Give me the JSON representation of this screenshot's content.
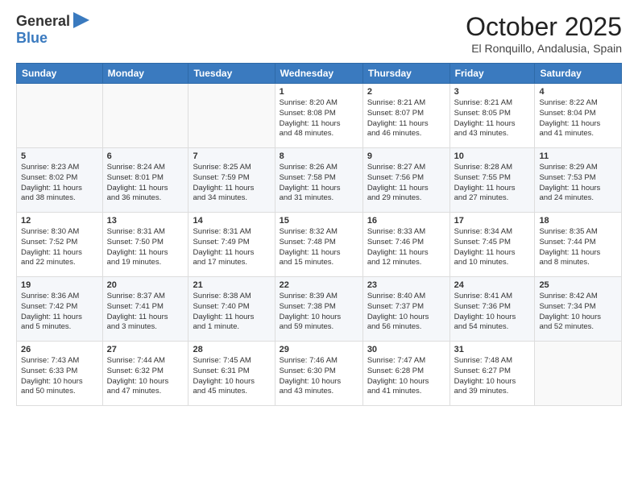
{
  "header": {
    "logo_line1": "General",
    "logo_line2": "Blue",
    "month": "October 2025",
    "location": "El Ronquillo, Andalusia, Spain"
  },
  "weekdays": [
    "Sunday",
    "Monday",
    "Tuesday",
    "Wednesday",
    "Thursday",
    "Friday",
    "Saturday"
  ],
  "weeks": [
    [
      {
        "day": "",
        "info": ""
      },
      {
        "day": "",
        "info": ""
      },
      {
        "day": "",
        "info": ""
      },
      {
        "day": "1",
        "info": "Sunrise: 8:20 AM\nSunset: 8:08 PM\nDaylight: 11 hours\nand 48 minutes."
      },
      {
        "day": "2",
        "info": "Sunrise: 8:21 AM\nSunset: 8:07 PM\nDaylight: 11 hours\nand 46 minutes."
      },
      {
        "day": "3",
        "info": "Sunrise: 8:21 AM\nSunset: 8:05 PM\nDaylight: 11 hours\nand 43 minutes."
      },
      {
        "day": "4",
        "info": "Sunrise: 8:22 AM\nSunset: 8:04 PM\nDaylight: 11 hours\nand 41 minutes."
      }
    ],
    [
      {
        "day": "5",
        "info": "Sunrise: 8:23 AM\nSunset: 8:02 PM\nDaylight: 11 hours\nand 38 minutes."
      },
      {
        "day": "6",
        "info": "Sunrise: 8:24 AM\nSunset: 8:01 PM\nDaylight: 11 hours\nand 36 minutes."
      },
      {
        "day": "7",
        "info": "Sunrise: 8:25 AM\nSunset: 7:59 PM\nDaylight: 11 hours\nand 34 minutes."
      },
      {
        "day": "8",
        "info": "Sunrise: 8:26 AM\nSunset: 7:58 PM\nDaylight: 11 hours\nand 31 minutes."
      },
      {
        "day": "9",
        "info": "Sunrise: 8:27 AM\nSunset: 7:56 PM\nDaylight: 11 hours\nand 29 minutes."
      },
      {
        "day": "10",
        "info": "Sunrise: 8:28 AM\nSunset: 7:55 PM\nDaylight: 11 hours\nand 27 minutes."
      },
      {
        "day": "11",
        "info": "Sunrise: 8:29 AM\nSunset: 7:53 PM\nDaylight: 11 hours\nand 24 minutes."
      }
    ],
    [
      {
        "day": "12",
        "info": "Sunrise: 8:30 AM\nSunset: 7:52 PM\nDaylight: 11 hours\nand 22 minutes."
      },
      {
        "day": "13",
        "info": "Sunrise: 8:31 AM\nSunset: 7:50 PM\nDaylight: 11 hours\nand 19 minutes."
      },
      {
        "day": "14",
        "info": "Sunrise: 8:31 AM\nSunset: 7:49 PM\nDaylight: 11 hours\nand 17 minutes."
      },
      {
        "day": "15",
        "info": "Sunrise: 8:32 AM\nSunset: 7:48 PM\nDaylight: 11 hours\nand 15 minutes."
      },
      {
        "day": "16",
        "info": "Sunrise: 8:33 AM\nSunset: 7:46 PM\nDaylight: 11 hours\nand 12 minutes."
      },
      {
        "day": "17",
        "info": "Sunrise: 8:34 AM\nSunset: 7:45 PM\nDaylight: 11 hours\nand 10 minutes."
      },
      {
        "day": "18",
        "info": "Sunrise: 8:35 AM\nSunset: 7:44 PM\nDaylight: 11 hours\nand 8 minutes."
      }
    ],
    [
      {
        "day": "19",
        "info": "Sunrise: 8:36 AM\nSunset: 7:42 PM\nDaylight: 11 hours\nand 5 minutes."
      },
      {
        "day": "20",
        "info": "Sunrise: 8:37 AM\nSunset: 7:41 PM\nDaylight: 11 hours\nand 3 minutes."
      },
      {
        "day": "21",
        "info": "Sunrise: 8:38 AM\nSunset: 7:40 PM\nDaylight: 11 hours\nand 1 minute."
      },
      {
        "day": "22",
        "info": "Sunrise: 8:39 AM\nSunset: 7:38 PM\nDaylight: 10 hours\nand 59 minutes."
      },
      {
        "day": "23",
        "info": "Sunrise: 8:40 AM\nSunset: 7:37 PM\nDaylight: 10 hours\nand 56 minutes."
      },
      {
        "day": "24",
        "info": "Sunrise: 8:41 AM\nSunset: 7:36 PM\nDaylight: 10 hours\nand 54 minutes."
      },
      {
        "day": "25",
        "info": "Sunrise: 8:42 AM\nSunset: 7:34 PM\nDaylight: 10 hours\nand 52 minutes."
      }
    ],
    [
      {
        "day": "26",
        "info": "Sunrise: 7:43 AM\nSunset: 6:33 PM\nDaylight: 10 hours\nand 50 minutes."
      },
      {
        "day": "27",
        "info": "Sunrise: 7:44 AM\nSunset: 6:32 PM\nDaylight: 10 hours\nand 47 minutes."
      },
      {
        "day": "28",
        "info": "Sunrise: 7:45 AM\nSunset: 6:31 PM\nDaylight: 10 hours\nand 45 minutes."
      },
      {
        "day": "29",
        "info": "Sunrise: 7:46 AM\nSunset: 6:30 PM\nDaylight: 10 hours\nand 43 minutes."
      },
      {
        "day": "30",
        "info": "Sunrise: 7:47 AM\nSunset: 6:28 PM\nDaylight: 10 hours\nand 41 minutes."
      },
      {
        "day": "31",
        "info": "Sunrise: 7:48 AM\nSunset: 6:27 PM\nDaylight: 10 hours\nand 39 minutes."
      },
      {
        "day": "",
        "info": ""
      }
    ]
  ]
}
